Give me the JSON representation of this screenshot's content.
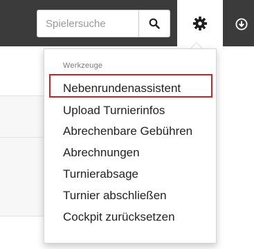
{
  "search": {
    "placeholder": "Spielersuche"
  },
  "icons": {
    "search": "search-icon",
    "settings": "gear-icon",
    "download": "download-icon"
  },
  "colors": {
    "topbar": "#3b3b3b",
    "highlight": "#e01b1b"
  },
  "menu": {
    "header": "Werkzeuge",
    "items": [
      {
        "label": "Nebenrundenassistent",
        "highlighted": true
      },
      {
        "label": "Upload Turnierinfos"
      },
      {
        "label": "Abrechenbare Gebühren"
      },
      {
        "label": "Abrechnungen"
      },
      {
        "label": "Turnierabsage"
      },
      {
        "label": "Turnier abschließen"
      },
      {
        "label": "Cockpit zurücksetzen"
      }
    ]
  }
}
